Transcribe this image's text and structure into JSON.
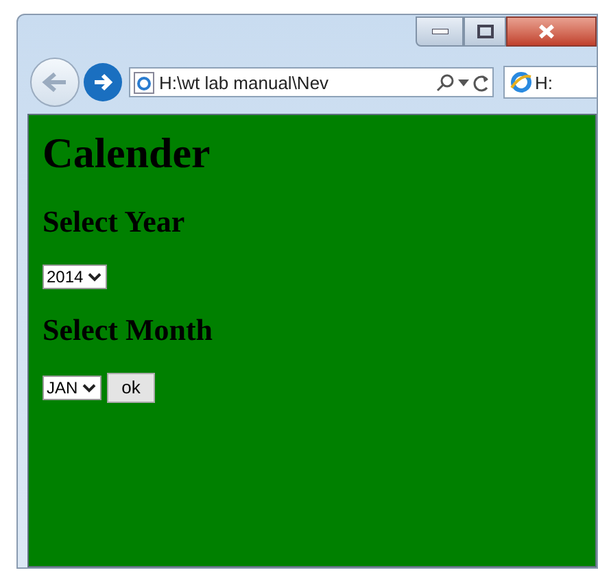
{
  "browser": {
    "address": "H:\\wt lab manual\\Nev",
    "tab": {
      "label": "H:",
      "selected": true
    }
  },
  "page": {
    "heading": "Calender",
    "sections": [
      {
        "label": "Select Year",
        "select": {
          "value": "2014"
        }
      },
      {
        "label": "Select Month",
        "select": {
          "value": "JAN"
        },
        "button": "ok"
      }
    ]
  }
}
